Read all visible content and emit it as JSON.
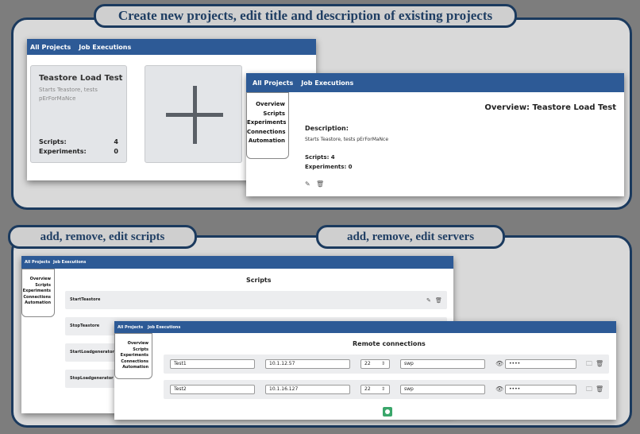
{
  "captions": {
    "top": "Create new projects, edit title and description of existing projects",
    "scripts": "add, remove, edit scripts",
    "servers": "add, remove, edit servers"
  },
  "nav": {
    "all_projects": "All Projects",
    "job_executions": "Job Executions"
  },
  "sidebar": [
    "Overview",
    "Scripts",
    "Experiments",
    "Connections",
    "Automation"
  ],
  "project_card": {
    "title": "Teastore Load Test",
    "description": "Starts Teastore, tests pErForMaNce",
    "scripts_label": "Scripts:",
    "scripts_count": "4",
    "experiments_label": "Experiments:",
    "experiments_count": "0"
  },
  "overview": {
    "title": "Overview: Teastore Load Test",
    "description_label": "Description:",
    "description": "Starts Teastore, tests pErForMaNce",
    "scripts": "Scripts: 4",
    "experiments": "Experiments: 0"
  },
  "scripts_page": {
    "title": "Scripts",
    "items": [
      "StartTeastore",
      "StopTeastore",
      "StartLoadgenerator",
      "StopLoadgenerator"
    ]
  },
  "connections_page": {
    "title": "Remote connections",
    "rows": [
      {
        "name": "Test1",
        "host": "10.1.12.57",
        "port": "22",
        "user": "swp",
        "password": "••••"
      },
      {
        "name": "Test2",
        "host": "10.1.16.127",
        "port": "22",
        "user": "swp",
        "password": "••••"
      }
    ]
  },
  "icons": [
    "plus-icon",
    "pencil-icon",
    "trash-icon",
    "eye-icon",
    "spinner-icon",
    "folder-icon",
    "add-circle-icon"
  ],
  "colors": {
    "nav": "#2d5a96",
    "frame": "#1b3a5e",
    "add_button": "#3aa66a"
  }
}
